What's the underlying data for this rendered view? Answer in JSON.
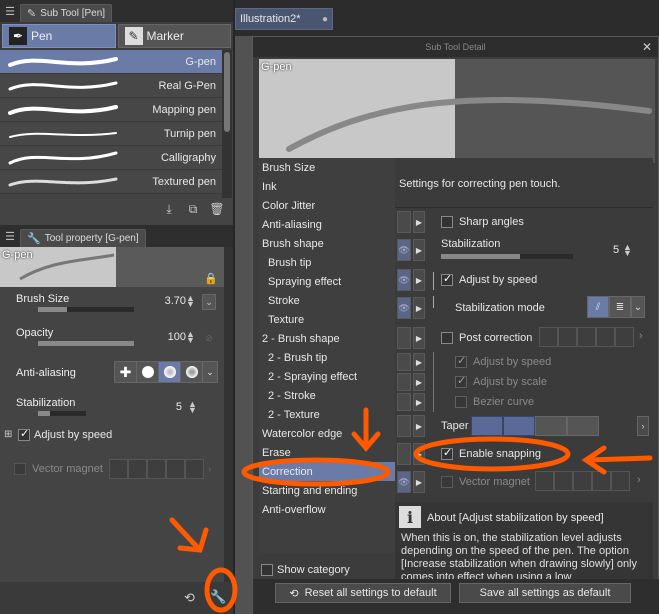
{
  "subtool_panel": {
    "tab_label": "Sub Tool [Pen]",
    "groups": [
      {
        "label": "Pen",
        "active": true
      },
      {
        "label": "Marker",
        "active": false
      }
    ],
    "brushes": [
      {
        "label": "G-pen",
        "selected": true
      },
      {
        "label": "Real G-Pen",
        "selected": false
      },
      {
        "label": "Mapping pen",
        "selected": false
      },
      {
        "label": "Turnip pen",
        "selected": false
      },
      {
        "label": "Calligraphy",
        "selected": false
      },
      {
        "label": "Textured pen",
        "selected": false
      }
    ]
  },
  "tool_property": {
    "tab_label": "Tool property [G-pen]",
    "preview_label": "G-pen",
    "brush_size": {
      "label": "Brush Size",
      "value": "3.70",
      "fill": 0.3
    },
    "opacity": {
      "label": "Opacity",
      "value": "100",
      "fill": 1.0
    },
    "anti_aliasing": {
      "label": "Anti-aliasing"
    },
    "stabilization": {
      "label": "Stabilization",
      "value": "5",
      "fill": 0.25
    },
    "adjust_by_speed": {
      "label": "Adjust by speed",
      "checked": true
    },
    "vector_magnet": {
      "label": "Vector magnet",
      "checked": false
    }
  },
  "canvas": {
    "doc_tab_label": "Illustration2*"
  },
  "detail_dialog": {
    "title": "Sub Tool Detail",
    "preview_label": "G-pen",
    "categories": [
      {
        "label": "Brush Size",
        "indent": false,
        "selected": false
      },
      {
        "label": "Ink",
        "indent": false,
        "selected": false
      },
      {
        "label": "Color Jitter",
        "indent": false,
        "selected": false
      },
      {
        "label": "Anti-aliasing",
        "indent": false,
        "selected": false
      },
      {
        "label": "Brush shape",
        "indent": false,
        "selected": false
      },
      {
        "label": "Brush tip",
        "indent": true,
        "selected": false
      },
      {
        "label": "Spraying effect",
        "indent": true,
        "selected": false
      },
      {
        "label": "Stroke",
        "indent": true,
        "selected": false
      },
      {
        "label": "Texture",
        "indent": true,
        "selected": false
      },
      {
        "label": "2 - Brush shape",
        "indent": false,
        "selected": false
      },
      {
        "label": "2 - Brush tip",
        "indent": true,
        "selected": false
      },
      {
        "label": "2 - Spraying effect",
        "indent": true,
        "selected": false
      },
      {
        "label": "2 - Stroke",
        "indent": true,
        "selected": false
      },
      {
        "label": "2 - Texture",
        "indent": true,
        "selected": false
      },
      {
        "label": "Watercolor edge",
        "indent": false,
        "selected": false
      },
      {
        "label": "Erase",
        "indent": false,
        "selected": false
      },
      {
        "label": "Correction",
        "indent": false,
        "selected": true
      },
      {
        "label": "Starting and ending",
        "indent": false,
        "selected": false
      },
      {
        "label": "Anti-overflow",
        "indent": false,
        "selected": false
      }
    ],
    "show_category_label": "Show category",
    "settings_description": "Settings for correcting pen touch.",
    "settings": {
      "sharp_angles": {
        "label": "Sharp angles",
        "checked": false
      },
      "stabilization": {
        "label": "Stabilization",
        "value": "5",
        "fill": 0.6
      },
      "adjust_by_speed": {
        "label": "Adjust by speed",
        "checked": true
      },
      "stabilization_mode": {
        "label": "Stabilization mode"
      },
      "post_correction": {
        "label": "Post correction",
        "checked": false
      },
      "post_adjust_by_speed": {
        "label": "Adjust by speed",
        "checked": true
      },
      "post_adjust_by_scale": {
        "label": "Adjust by scale",
        "checked": true
      },
      "bezier_curve": {
        "label": "Bezier curve",
        "checked": false
      },
      "taper": {
        "label": "Taper"
      },
      "enable_snapping": {
        "label": "Enable snapping",
        "checked": true
      },
      "vector_magnet": {
        "label": "Vector magnet",
        "checked": false
      }
    },
    "about": {
      "title": "About [Adjust stabilization by speed]",
      "text": "When this is on, the stabilization level adjusts depending on the speed of the pen. The option [Increase stabilization when drawing slowly] only comes into effect when using a low"
    },
    "buttons": {
      "reset": "Reset all settings to default",
      "save": "Save all settings as default"
    }
  },
  "colors": {
    "accent": "#6a7ba8",
    "annotation": "#ff5a00"
  }
}
